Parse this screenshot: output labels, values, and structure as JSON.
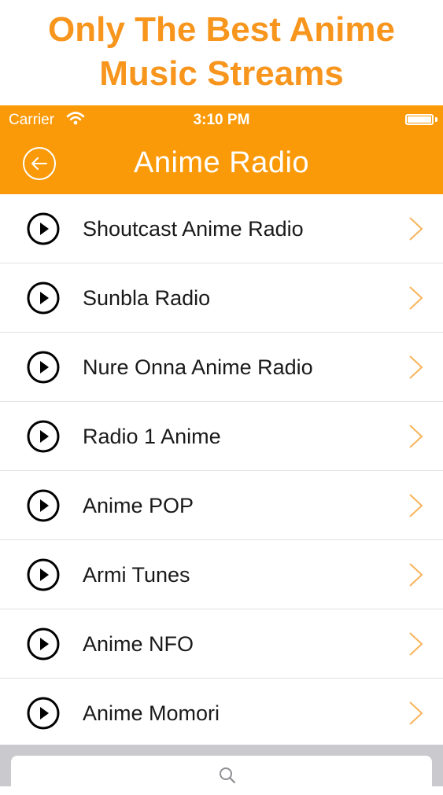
{
  "promo": {
    "line1": "Only The Best Anime",
    "line2": "Music Streams"
  },
  "status_bar": {
    "carrier": "Carrier",
    "time": "3:10 PM"
  },
  "nav": {
    "title": "Anime Radio",
    "back_icon": "back-arrow-circle-icon"
  },
  "stations": [
    {
      "label": "Shoutcast Anime Radio"
    },
    {
      "label": "Sunbla Radio"
    },
    {
      "label": "Nure Onna Anime Radio"
    },
    {
      "label": "Radio 1 Anime"
    },
    {
      "label": "Anime POP"
    },
    {
      "label": "Armi Tunes"
    },
    {
      "label": "Anime NFO"
    },
    {
      "label": "Anime Momori"
    }
  ],
  "search": {
    "icon": "search-icon"
  },
  "colors": {
    "accent": "#fa9a08",
    "promo_text": "#f7951d",
    "chevron": "#f7b45a"
  }
}
